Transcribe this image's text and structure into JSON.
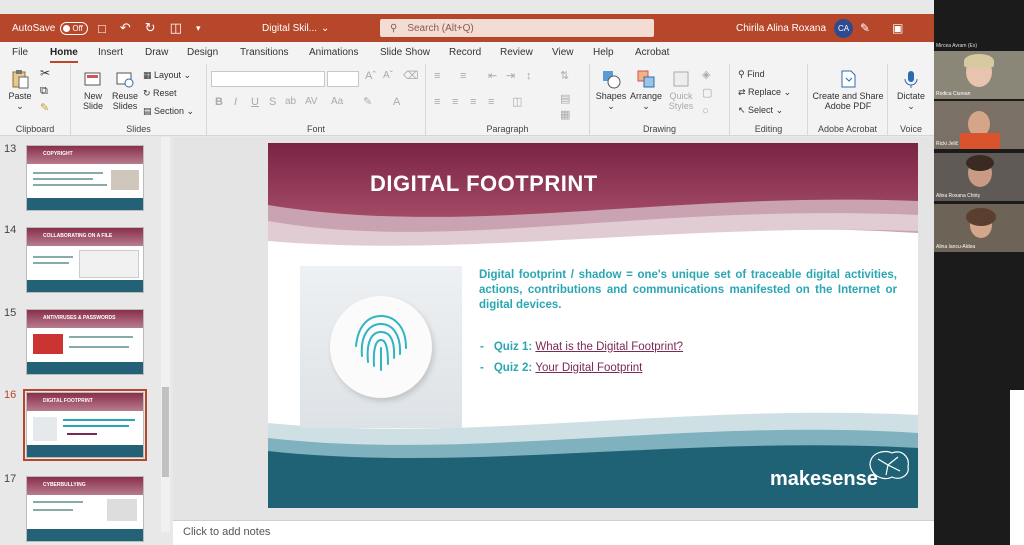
{
  "titlebar": {
    "autosave": "AutoSave",
    "toggle": "Off",
    "filename": "Digital Skil...",
    "search_placeholder": "Search (Alt+Q)",
    "user_name": "Chirila Alina Roxana",
    "user_initials": "CA"
  },
  "menu": [
    "File",
    "Home",
    "Insert",
    "Draw",
    "Design",
    "Transitions",
    "Animations",
    "Slide Show",
    "Record",
    "Review",
    "View",
    "Help",
    "Acrobat"
  ],
  "ribbon": {
    "clipboard": {
      "label": "Clipboard",
      "paste": "Paste"
    },
    "slides": {
      "label": "Slides",
      "new_slide": "New Slide",
      "reuse_slides": "Reuse Slides",
      "layout": "Layout",
      "reset": "Reset",
      "section": "Section"
    },
    "font": {
      "label": "Font"
    },
    "paragraph": {
      "label": "Paragraph"
    },
    "drawing": {
      "label": "Drawing",
      "shapes": "Shapes",
      "arrange": "Arrange",
      "quick_styles": "Quick Styles"
    },
    "editing": {
      "label": "Editing",
      "find": "Find",
      "replace": "Replace",
      "select": "Select"
    },
    "acrobat": {
      "label": "Adobe Acrobat",
      "create_share": "Create and Share Adobe PDF"
    },
    "voice": {
      "label": "Voice",
      "dictate": "Dictate"
    }
  },
  "thumbnails": [
    {
      "num": "13",
      "title": "COPYRIGHT"
    },
    {
      "num": "14",
      "title": "COLLABORATING ON A FILE"
    },
    {
      "num": "15",
      "title": "ANTIVIRUSES & PASSWORDS"
    },
    {
      "num": "16",
      "title": "DIGITAL FOOTPRINT"
    },
    {
      "num": "17",
      "title": "CYBERBULLYING"
    }
  ],
  "slide": {
    "title": "DIGITAL FOOTPRINT",
    "body": "Digital footprint / shadow = one's unique set of traceable digital activities, actions, contributions and communications manifested on the Internet or digital devices.",
    "quiz1_prefix": "Quiz 1:",
    "quiz1_link": "What is the Digital Footprint?",
    "quiz2_prefix": "Quiz 2:",
    "quiz2_link": "Your Digital Footprint",
    "logo": "makesense"
  },
  "notes_placeholder": "Click to add notes",
  "participants": [
    {
      "name": "Mircea Avram (Ex)"
    },
    {
      "name": "Rodica Ciurean"
    },
    {
      "name": "Ricki Jelič"
    },
    {
      "name": "Alina Roxana Chiriș"
    },
    {
      "name": "Alina Iancu-Aldea"
    }
  ],
  "colors": {
    "accent": "#b7472a",
    "slide_maroon": "#8a2f4b",
    "slide_teal": "#1f6275",
    "body_text": "#2aa7b3",
    "link": "#7b2a55"
  }
}
